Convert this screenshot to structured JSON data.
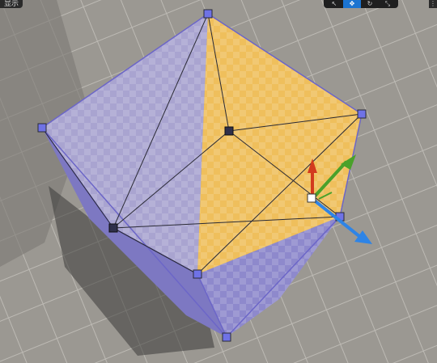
{
  "viewport": {
    "label": "显示",
    "tools": [
      {
        "name": "select-tool",
        "glyph": "↖",
        "active": false
      },
      {
        "name": "translate-tool",
        "glyph": "✥",
        "active": true
      },
      {
        "name": "rotate-tool",
        "glyph": "↻",
        "active": false
      },
      {
        "name": "scale-tool",
        "glyph": "⤡",
        "active": false
      }
    ],
    "extra_glyph": "⋮"
  },
  "colors": {
    "floor": "#9b9892",
    "grid_line": "#b9b6b0",
    "cube_top_left": "#a7a2cc",
    "cube_top_right": "#f0c060",
    "cube_side": "#8c87c8",
    "cube_edge": "#6c66c8",
    "wire": "#2a2a35",
    "vertex": "#6f72e6",
    "gizmo_x": "#d23a1e",
    "gizmo_y": "#4aa12a",
    "gizmo_z": "#2e84e6"
  }
}
